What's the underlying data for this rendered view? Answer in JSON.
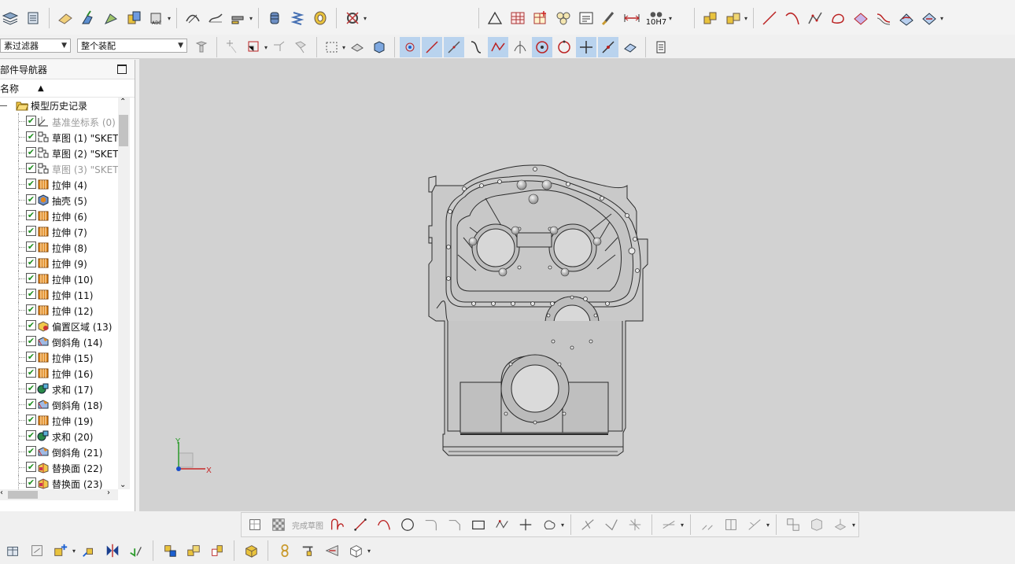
{
  "toolbar": {
    "tolerance_label": "10H7",
    "filter_combo": "素过滤器",
    "assembly_combo": "整个装配"
  },
  "navigator": {
    "title": "部件导航器",
    "column_name": "名称",
    "sort_indicator": "▲",
    "root": "模型历史记录",
    "features": [
      {
        "label": "基准坐标系 (0)",
        "icon": "datum-csys-icon",
        "dim": true
      },
      {
        "label": "草图 (1) \"SKET",
        "icon": "sketch-icon",
        "dim": false
      },
      {
        "label": "草图 (2) \"SKET",
        "icon": "sketch-icon",
        "dim": false
      },
      {
        "label": "草图 (3) \"SKET",
        "icon": "sketch-icon",
        "dim": true
      },
      {
        "label": "拉伸 (4)",
        "icon": "extrude-icon",
        "dim": false
      },
      {
        "label": "抽壳 (5)",
        "icon": "shell-icon",
        "dim": false
      },
      {
        "label": "拉伸 (6)",
        "icon": "extrude-icon",
        "dim": false
      },
      {
        "label": "拉伸 (7)",
        "icon": "extrude-icon",
        "dim": false
      },
      {
        "label": "拉伸 (8)",
        "icon": "extrude-icon",
        "dim": false
      },
      {
        "label": "拉伸 (9)",
        "icon": "extrude-icon",
        "dim": false
      },
      {
        "label": "拉伸 (10)",
        "icon": "extrude-icon",
        "dim": false
      },
      {
        "label": "拉伸 (11)",
        "icon": "extrude-icon",
        "dim": false
      },
      {
        "label": "拉伸 (12)",
        "icon": "extrude-icon",
        "dim": false
      },
      {
        "label": "偏置区域 (13)",
        "icon": "offset-region-icon",
        "dim": false
      },
      {
        "label": "倒斜角 (14)",
        "icon": "chamfer-icon",
        "dim": false
      },
      {
        "label": "拉伸 (15)",
        "icon": "extrude-icon",
        "dim": false
      },
      {
        "label": "拉伸 (16)",
        "icon": "extrude-icon",
        "dim": false
      },
      {
        "label": "求和 (17)",
        "icon": "unite-icon",
        "dim": false
      },
      {
        "label": "倒斜角 (18)",
        "icon": "chamfer-icon",
        "dim": false
      },
      {
        "label": "拉伸 (19)",
        "icon": "extrude-icon",
        "dim": false
      },
      {
        "label": "求和 (20)",
        "icon": "unite-icon",
        "dim": false
      },
      {
        "label": "倒斜角 (21)",
        "icon": "chamfer-icon",
        "dim": false
      },
      {
        "label": "替换面 (22)",
        "icon": "replace-face-icon",
        "dim": false
      },
      {
        "label": "替换面 (23)",
        "icon": "replace-face-icon",
        "dim": false
      }
    ]
  },
  "viewport": {
    "axis_x": "X",
    "axis_y": "Y"
  },
  "sketch_toolbar": {
    "finish_sketch": "完成草图"
  },
  "colors": {
    "viewport_bg": "#d2d2d2",
    "part_fill": "#c9c9c9",
    "part_edge": "#2a2a2a",
    "checkbox_green": "#1e8f1e",
    "extrude_orange": "#e0871c"
  }
}
